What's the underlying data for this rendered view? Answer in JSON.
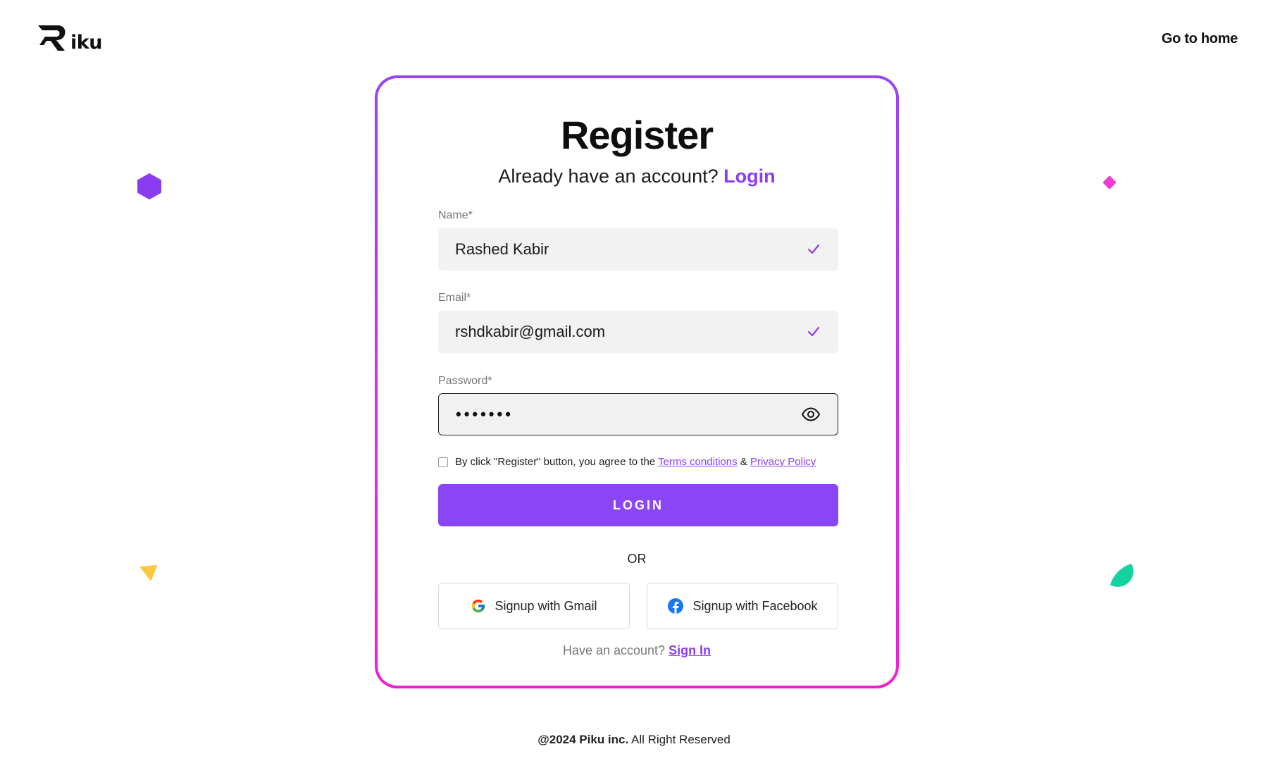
{
  "header": {
    "logo_text": "iku",
    "go_home_label": "Go to home"
  },
  "form": {
    "title": "Register",
    "subtitle_text": "Already have an account?",
    "subtitle_link": "Login",
    "fields": [
      {
        "label": "Name*",
        "value": "Rashed Kabir"
      },
      {
        "label": "Email*",
        "value": "rshdkabir@gmail.com"
      },
      {
        "label": "Password*",
        "value": "•••••••"
      }
    ],
    "agree_text": "By click \"Register\" button, you agree to the",
    "terms_link": "Terms conditions",
    "amp": "&",
    "privacy_link": "Privacy Policy",
    "submit_label": "LOGIN",
    "or_text": "OR",
    "gmail_label": "Signup with Gmail",
    "facebook_label": "Signup with Facebook",
    "have_account_text": "Have an account?",
    "sign_in_link": "Sign In"
  },
  "footer": {
    "brand": "@2024 Piku inc.",
    "rights": "All Right Reserved"
  },
  "colors": {
    "accent": "#8a45f5",
    "link": "#8a3df0",
    "border_gradient_top": "#9646f2",
    "border_gradient_bottom": "#f01ed2",
    "deco_hexagon": "#8a3df0",
    "deco_diamond": "#f03cd2",
    "deco_triangle": "#fcc83c",
    "deco_semicircle": "#14d2a0"
  },
  "icons": {
    "logo": "piku-r-logo-icon",
    "valid": "check-icon",
    "password_toggle": "eye-icon",
    "gmail": "google-icon",
    "facebook": "facebook-icon"
  }
}
